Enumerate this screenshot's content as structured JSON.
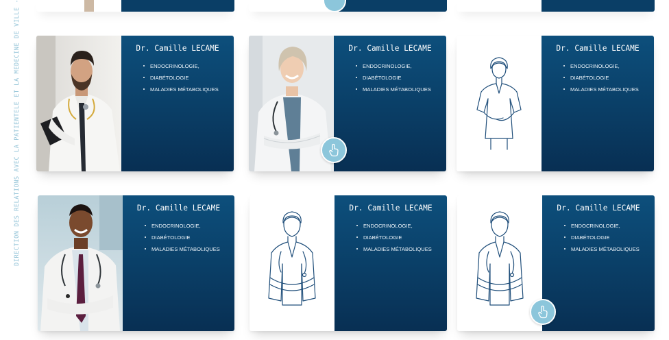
{
  "sidebar": {
    "vertical_label": "DIRECTION DES RELATIONS AVEC LA PATIENTÈLE ET LA MÉDECINE DE VILLE - D"
  },
  "cards": [
    {
      "name": "Dr. Camille LECAME",
      "specialties": [
        "Endocrinologie,",
        "diabétologie",
        "maladies métaboliques"
      ],
      "photo": "male-doctor-beard-photo",
      "has_touch_badge": false
    },
    {
      "name": "Dr. Camille LECAME",
      "specialties": [
        "Endocrinologie,",
        "diabétologie",
        "maladies métaboliques"
      ],
      "photo": "female-doctor-smiling-photo",
      "has_touch_badge": true
    },
    {
      "name": "Dr. Camille LECAME",
      "specialties": [
        "Endocrinologie,",
        "diabétologie",
        "maladies métaboliques"
      ],
      "photo": "nurse-line-illustration",
      "has_touch_badge": false
    },
    {
      "name": "Dr. Camille LECAME",
      "specialties": [
        "Endocrinologie,",
        "diabétologie",
        "maladies métaboliques"
      ],
      "photo": "male-doctor-smiling-photo",
      "has_touch_badge": false
    },
    {
      "name": "Dr. Camille LECAME",
      "specialties": [
        "Endocrinologie,",
        "diabétologie",
        "maladies métaboliques"
      ],
      "photo": "doctor-line-illustration",
      "has_touch_badge": false
    },
    {
      "name": "Dr. Camille LECAME",
      "specialties": [
        "Endocrinologie,",
        "diabétologie",
        "maladies métaboliques"
      ],
      "photo": "doctor-line-illustration",
      "has_touch_badge": true
    }
  ],
  "colors": {
    "panel": "#0a3e66",
    "accent": "#8cc6db",
    "line_art": "#1f4e7a"
  },
  "icons": {
    "touch_badge": "tap-finger-icon"
  }
}
